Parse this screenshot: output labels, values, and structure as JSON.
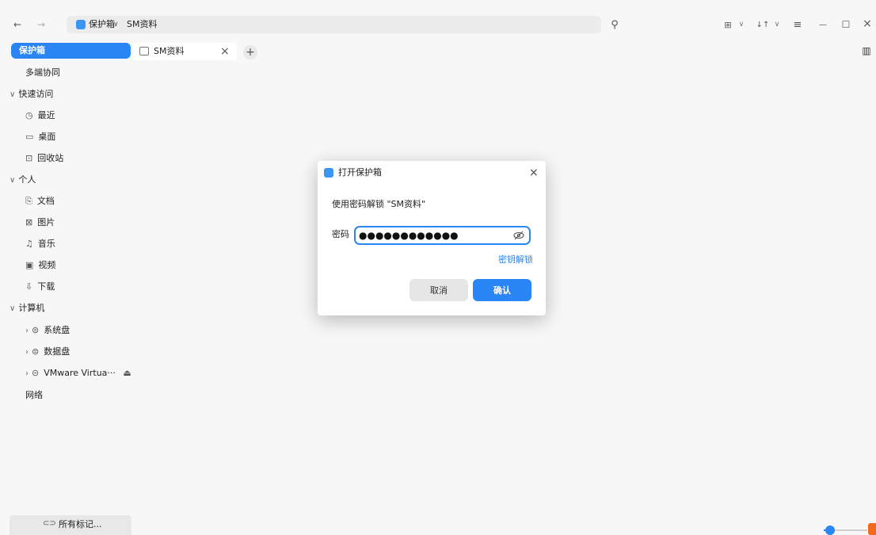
{
  "titlebar": {
    "back_icon": "←",
    "forward_icon": "→",
    "location_label": "保护箱",
    "location_chevron": "∨",
    "path_label": "SM资料",
    "search_icon": "⚲",
    "view_icon": "⊞",
    "sort_icon": "↓↑",
    "menu_icon": "≡",
    "minimize_icon": "—",
    "maximize_icon": "☐",
    "close_icon": "×",
    "dropdown_icon": "∨",
    "sidepanel_icon": "▥"
  },
  "sidebar": {
    "vault": "保护箱",
    "multi_device": "多端协同",
    "quick_access": "快速访问",
    "recent": "最近",
    "desktop": "桌面",
    "trash": "回收站",
    "personal": "个人",
    "documents": "文档",
    "pictures": "图片",
    "music": "音乐",
    "videos": "视频",
    "downloads": "下载",
    "computer": "计算机",
    "system_disk": "系统盘",
    "data_disk": "数据盘",
    "vmware": "VMware Virtua···",
    "network": "网络",
    "all_tags": "所有标记..."
  },
  "tabs": {
    "active_label": "SM资料",
    "close": "×",
    "new_tab": "+"
  },
  "dialog": {
    "title": "打开保护箱",
    "close": "×",
    "prompt": "使用密码解锁 \"SM资料\"",
    "password_label": "密码",
    "password_value": "●●●●●●●●●●●●",
    "key_unlock": "密钥解锁",
    "cancel": "取消",
    "confirm": "确认"
  },
  "colors": {
    "accent": "#2a86f5",
    "vault_icon": "#3b95f2"
  }
}
